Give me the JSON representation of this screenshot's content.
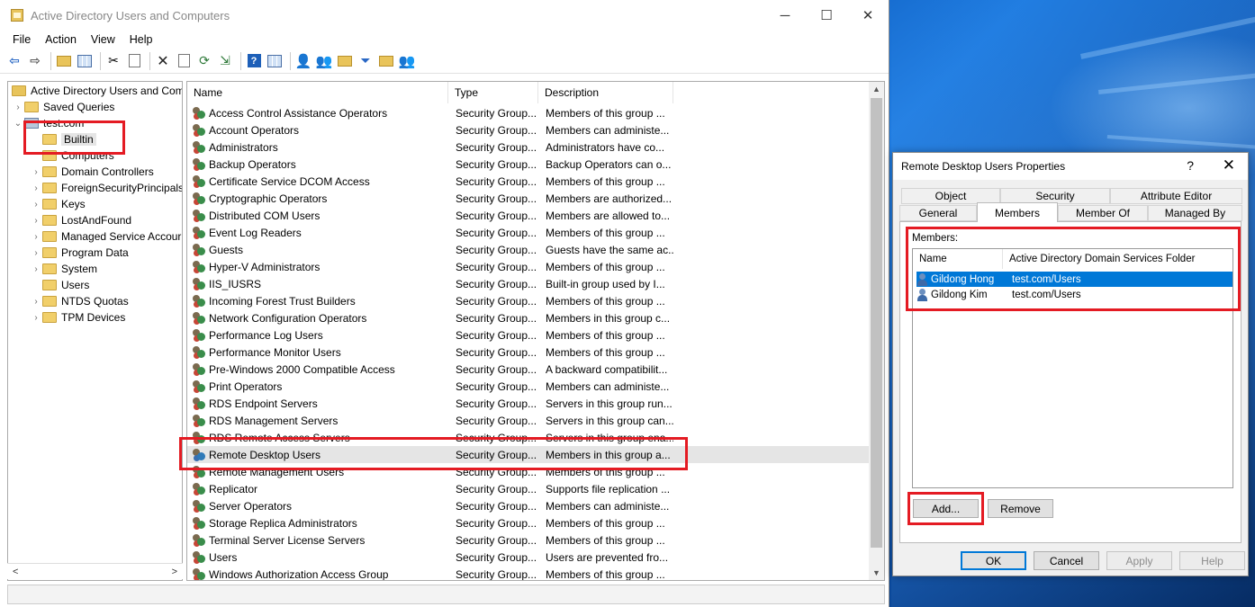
{
  "main_window": {
    "title": "Active Directory Users and Computers",
    "controls": {
      "minimize": "─",
      "maximize": "☐",
      "close": "✕"
    },
    "menu": [
      "File",
      "Action",
      "View",
      "Help"
    ]
  },
  "tree": {
    "root": "Active Directory Users and Com",
    "saved_queries": "Saved Queries",
    "domain": "test.com",
    "items": [
      "Builtin",
      "Computers",
      "Domain Controllers",
      "ForeignSecurityPrincipals",
      "Keys",
      "LostAndFound",
      "Managed Service Accour",
      "Program Data",
      "System",
      "Users",
      "NTDS Quotas",
      "TPM Devices"
    ],
    "scroll_left": "<",
    "scroll_right": ">"
  },
  "list": {
    "columns": [
      "Name",
      "Type",
      "Description"
    ],
    "rows": [
      {
        "name": "Access Control Assistance Operators",
        "type": "Security Group...",
        "desc": "Members of this group ..."
      },
      {
        "name": "Account Operators",
        "type": "Security Group...",
        "desc": "Members can administe..."
      },
      {
        "name": "Administrators",
        "type": "Security Group...",
        "desc": "Administrators have co..."
      },
      {
        "name": "Backup Operators",
        "type": "Security Group...",
        "desc": "Backup Operators can o..."
      },
      {
        "name": "Certificate Service DCOM Access",
        "type": "Security Group...",
        "desc": "Members of this group ..."
      },
      {
        "name": "Cryptographic Operators",
        "type": "Security Group...",
        "desc": "Members are authorized..."
      },
      {
        "name": "Distributed COM Users",
        "type": "Security Group...",
        "desc": "Members are allowed to..."
      },
      {
        "name": "Event Log Readers",
        "type": "Security Group...",
        "desc": "Members of this group ..."
      },
      {
        "name": "Guests",
        "type": "Security Group...",
        "desc": "Guests have the same ac..."
      },
      {
        "name": "Hyper-V Administrators",
        "type": "Security Group...",
        "desc": "Members of this group ..."
      },
      {
        "name": "IIS_IUSRS",
        "type": "Security Group...",
        "desc": "Built-in group used by I..."
      },
      {
        "name": "Incoming Forest Trust Builders",
        "type": "Security Group...",
        "desc": "Members of this group ..."
      },
      {
        "name": "Network Configuration Operators",
        "type": "Security Group...",
        "desc": "Members in this group c..."
      },
      {
        "name": "Performance Log Users",
        "type": "Security Group...",
        "desc": "Members of this group ..."
      },
      {
        "name": "Performance Monitor Users",
        "type": "Security Group...",
        "desc": "Members of this group ..."
      },
      {
        "name": "Pre-Windows 2000 Compatible Access",
        "type": "Security Group...",
        "desc": "A backward compatibilit..."
      },
      {
        "name": "Print Operators",
        "type": "Security Group...",
        "desc": "Members can administe..."
      },
      {
        "name": "RDS Endpoint Servers",
        "type": "Security Group...",
        "desc": "Servers in this group run..."
      },
      {
        "name": "RDS Management Servers",
        "type": "Security Group...",
        "desc": "Servers in this group can..."
      },
      {
        "name": "RDS Remote Access Servers",
        "type": "Security Group...",
        "desc": "Servers in this group ena..."
      },
      {
        "name": "Remote Desktop Users",
        "type": "Security Group...",
        "desc": "Members in this group a..."
      },
      {
        "name": "Remote Management Users",
        "type": "Security Group...",
        "desc": "Members of this group ..."
      },
      {
        "name": "Replicator",
        "type": "Security Group...",
        "desc": "Supports file replication ..."
      },
      {
        "name": "Server Operators",
        "type": "Security Group...",
        "desc": "Members can administe..."
      },
      {
        "name": "Storage Replica Administrators",
        "type": "Security Group...",
        "desc": "Members of this group ..."
      },
      {
        "name": "Terminal Server License Servers",
        "type": "Security Group...",
        "desc": "Members of this group ..."
      },
      {
        "name": "Users",
        "type": "Security Group...",
        "desc": "Users are prevented fro..."
      },
      {
        "name": "Windows Authorization Access Group",
        "type": "Security Group...",
        "desc": "Members of this group ..."
      }
    ]
  },
  "dialog": {
    "title": "Remote Desktop Users Properties",
    "help": "?",
    "close": "✕",
    "tabs_row1": [
      "Object",
      "Security",
      "Attribute Editor"
    ],
    "tabs_row2": [
      "General",
      "Members",
      "Member Of",
      "Managed By"
    ],
    "members_label": "Members:",
    "members_columns": [
      "Name",
      "Active Directory Domain Services Folder"
    ],
    "members": [
      {
        "name": "Gildong Hong",
        "folder": "test.com/Users"
      },
      {
        "name": "Gildong Kim",
        "folder": "test.com/Users"
      }
    ],
    "add_button": "Add...",
    "remove_button": "Remove",
    "ok_button": "OK",
    "cancel_button": "Cancel",
    "apply_button": "Apply",
    "help_button": "Help"
  },
  "colors": {
    "highlight": "#e41b23",
    "selection": "#0078d7"
  }
}
